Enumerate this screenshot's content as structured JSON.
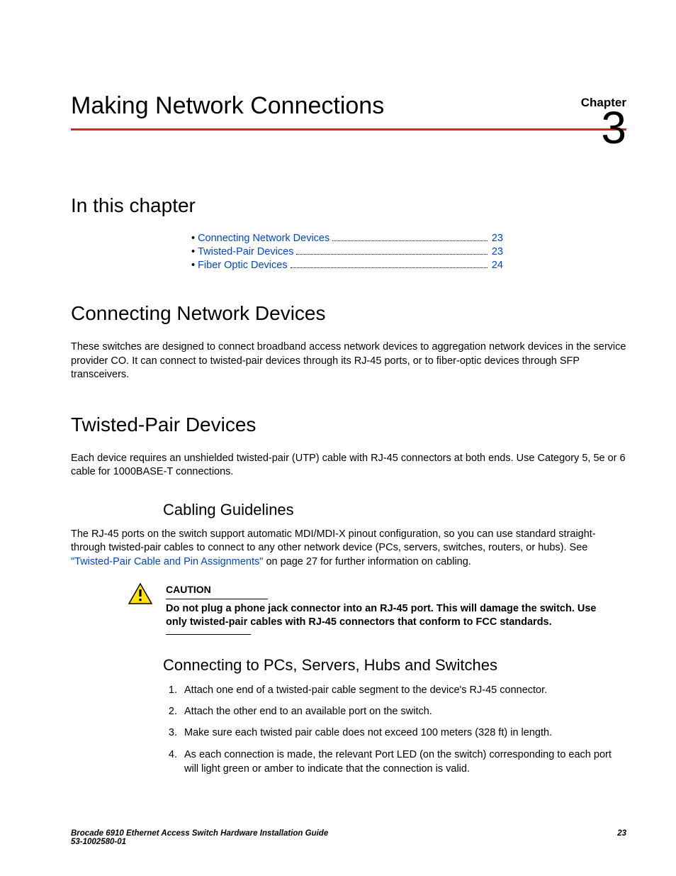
{
  "header": {
    "chapter_label": "Chapter",
    "chapter_number": "3",
    "page_title": "Making Network Connections"
  },
  "sections": {
    "in_this_chapter": {
      "heading": "In this chapter",
      "toc": [
        {
          "label": "Connecting Network Devices",
          "page": "23"
        },
        {
          "label": "Twisted-Pair Devices",
          "page": "23"
        },
        {
          "label": "Fiber Optic Devices",
          "page": "24"
        }
      ],
      "bullet": "•"
    },
    "connecting_network_devices": {
      "heading": "Connecting Network Devices",
      "body": "These switches are designed to connect broadband access network devices to aggregation network devices in the service provider CO. It can connect to twisted-pair devices through its RJ-45 ports, or to fiber-optic devices through SFP transceivers."
    },
    "twisted_pair_devices": {
      "heading": "Twisted-Pair Devices",
      "intro": "Each device requires an unshielded twisted-pair (UTP) cable with RJ-45 connectors at both ends. Use Category 5, 5e or 6 cable for 1000BASE-T connections.",
      "cabling_guidelines": {
        "heading": "Cabling Guidelines",
        "body_before_link": "The RJ-45 ports on the switch support automatic MDI/MDI-X pinout configuration, so you can use standard straight-through twisted-pair cables to connect to any other network device (PCs, servers, switches, routers, or hubs). See ",
        "link_text": "\"Twisted-Pair Cable and Pin Assignments\"",
        "body_after_link": " on page 27 for further information on cabling."
      },
      "caution": {
        "label": "CAUTION",
        "body": "Do not plug a phone jack connector into an RJ-45 port. This will damage the switch. Use only twisted-pair cables with RJ-45 connectors that conform to FCC standards."
      },
      "connecting_to": {
        "heading": "Connecting to PCs, Servers, Hubs and Switches",
        "steps": [
          "Attach one end of a twisted-pair cable segment to the device's RJ-45 connector.",
          "Attach the other end to an available port on the switch.",
          "Make sure each twisted pair cable does not exceed 100 meters (328 ft) in length.",
          "As each connection is made, the relevant Port LED (on the switch) corresponding to each port will light green or amber to indicate that the connection is valid."
        ]
      }
    }
  },
  "footer": {
    "doc_title": "Brocade 6910 Ethernet Access Switch Hardware Installation Guide",
    "doc_number": "53-1002580-01",
    "page_number": "23"
  }
}
